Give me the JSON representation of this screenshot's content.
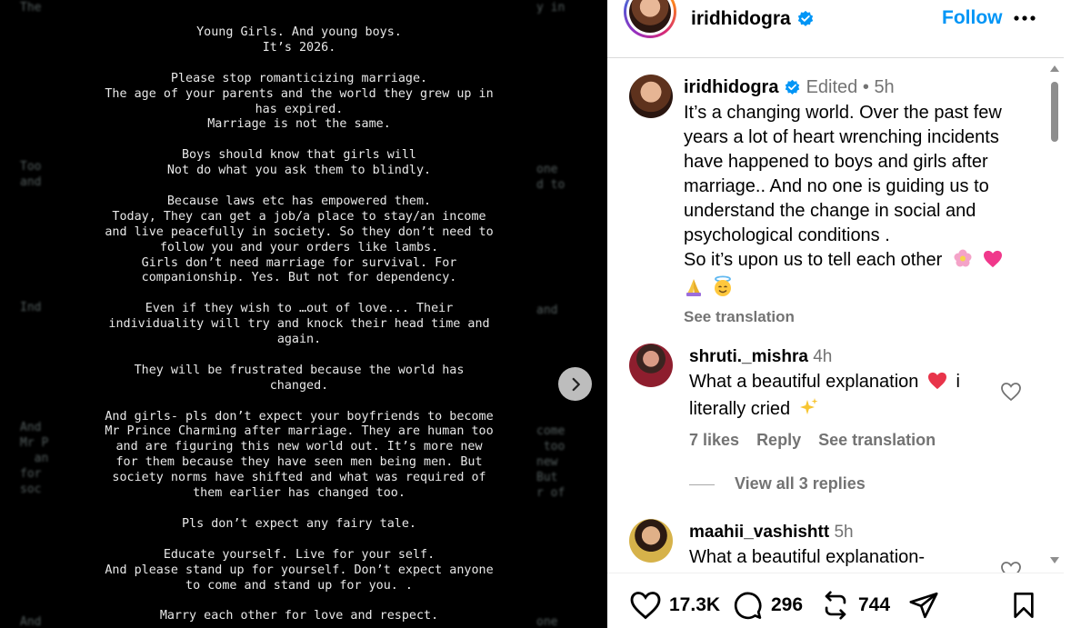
{
  "media": {
    "stanzas": [
      [
        "Young Girls. And young boys.",
        "It’s 2026."
      ],
      [
        "Please stop romanticizing marriage.",
        "The age of your parents and the world they grew up in",
        "has expired.",
        "Marriage is not the same."
      ],
      [
        "Boys should know that girls will",
        "Not do what you ask them to blindly."
      ],
      [
        "Because laws etc has empowered them.",
        "Today, They can get a job/a place to stay/an income",
        "and live peacefully in society. So they don’t need to",
        "follow you and your orders like lambs.",
        "Girls don’t need marriage for survival. For",
        "companionship. Yes. But not for dependency."
      ],
      [
        "Even if they wish to …out of love... Their",
        "individuality will try and knock their head time and",
        "again."
      ],
      [
        "They will be frustrated because the world has",
        "changed."
      ],
      [
        "And girls- pls don’t expect your boyfriends to become",
        "Mr Prince Charming after marriage. They are human too",
        "and are figuring this new world out. It’s more new",
        "for them because they have seen men being men. But",
        "society norms  have shifted and what was required of",
        "them earlier has changed too."
      ],
      [
        "Pls don’t expect any fairy tale."
      ],
      [
        "Educate yourself. Live for your self.",
        "And please stand up for yourself. Don’t expect anyone",
        "to come and stand up for you. ."
      ],
      [
        "Marry each other for love and respect."
      ]
    ]
  },
  "header": {
    "username": "iridhidogra",
    "follow_label": "Follow"
  },
  "caption": {
    "username": "iridhidogra",
    "edited": "Edited",
    "dot": "•",
    "time": "5h",
    "text": "It’s a changing world. Over the past few years a lot of heart wrenching incidents have happened to boys and girls after marriage.. And no one is guiding us to understand the change in social and psychological conditions .",
    "text2": "So it’s upon us to tell each other",
    "see_translation": "See translation"
  },
  "comments": [
    {
      "username": "shruti._mishra",
      "time": "4h",
      "text_a": "What a beautiful explanation",
      "text_b": "i literally cried",
      "likes": "7 likes",
      "reply": "Reply",
      "see_translation": "See translation",
      "view_replies": "View all 3 replies"
    },
    {
      "username": "maahii_vashishtt",
      "time": "5h",
      "text_a": "What a beautiful explanation-"
    }
  ],
  "actions": {
    "likes": "17.3K",
    "comments": "296",
    "reposts": "744"
  },
  "colors": {
    "accent": "#0095f6",
    "muted": "#737373",
    "like_heart": "#ed4956"
  }
}
